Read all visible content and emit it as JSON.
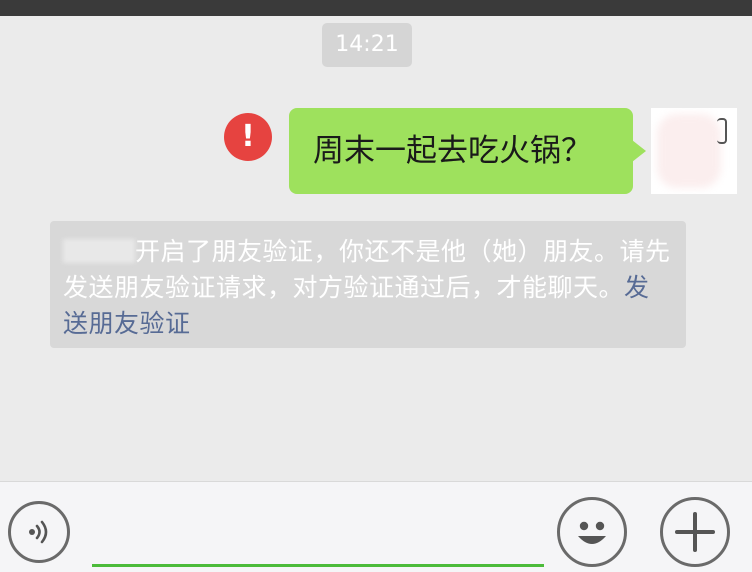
{
  "chat": {
    "timestamp": "14:21",
    "message": {
      "text": "周末一起去吃火锅？",
      "status_icon": "error-icon",
      "status_icon_glyph": "!",
      "bubble_color": "#9ee15d",
      "error_color": "#e64340"
    },
    "system_notice": {
      "text": "开启了朋友验证，你还不是他（她）朋友。请先发送朋友验证请求，对方验证通过后，才能聊天。",
      "link_text": "发送朋友验证",
      "link_color": "#576b95"
    }
  },
  "input_bar": {
    "voice_icon": "voice-icon",
    "text_value": "",
    "emoji_icon": "emoji-icon",
    "more_icon": "plus-icon",
    "accent_color": "#4cbb3a"
  }
}
